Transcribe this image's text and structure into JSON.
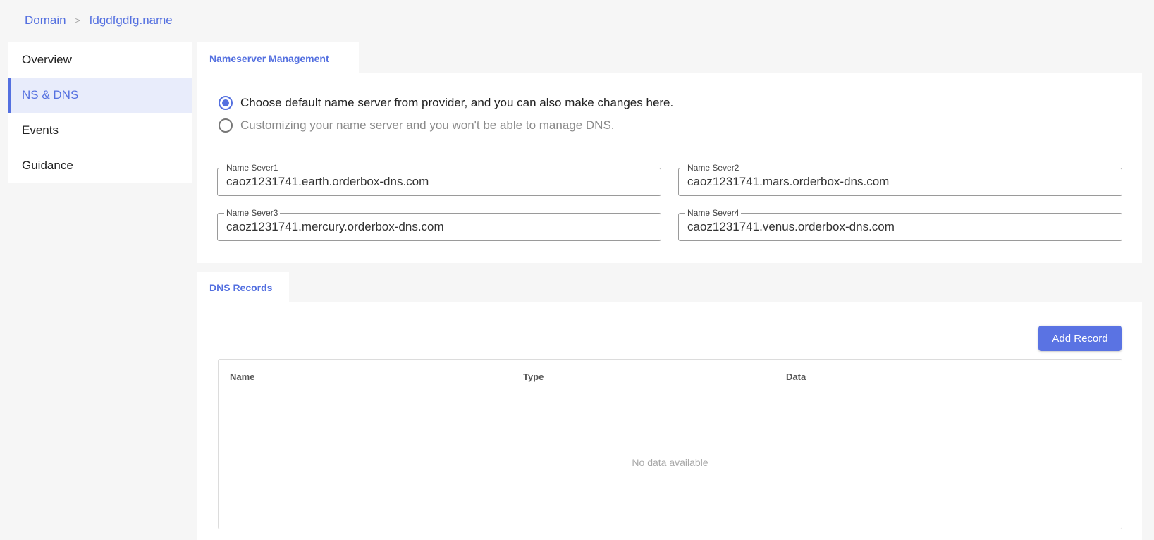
{
  "breadcrumb": {
    "root": "Domain",
    "separator": ">",
    "current": "fdgdfgdfg.name"
  },
  "sidebar": {
    "items": [
      {
        "label": "Overview"
      },
      {
        "label": "NS & DNS"
      },
      {
        "label": "Events"
      },
      {
        "label": "Guidance"
      }
    ],
    "active": "NS & DNS"
  },
  "nameserver": {
    "tab_label": "Nameserver Management",
    "options": [
      {
        "label": "Choose default name server from provider, and you can also make changes here.",
        "checked": true
      },
      {
        "label": "Customizing your name server and you won't be able to manage DNS.",
        "checked": false
      }
    ],
    "fields": [
      {
        "legend": "Name Sever1",
        "value": "caoz1231741.earth.orderbox-dns.com"
      },
      {
        "legend": "Name Sever2",
        "value": "caoz1231741.mars.orderbox-dns.com"
      },
      {
        "legend": "Name Sever3",
        "value": "caoz1231741.mercury.orderbox-dns.com"
      },
      {
        "legend": "Name Sever4",
        "value": "caoz1231741.venus.orderbox-dns.com"
      }
    ]
  },
  "dns": {
    "tab_label": "DNS Records",
    "add_button": "Add Record",
    "columns": [
      "Name",
      "Type",
      "Data"
    ],
    "empty_text": "No data available"
  },
  "colors": {
    "accent": "#5470e0",
    "button": "#5a73e3",
    "background": "#f6f6f6"
  }
}
